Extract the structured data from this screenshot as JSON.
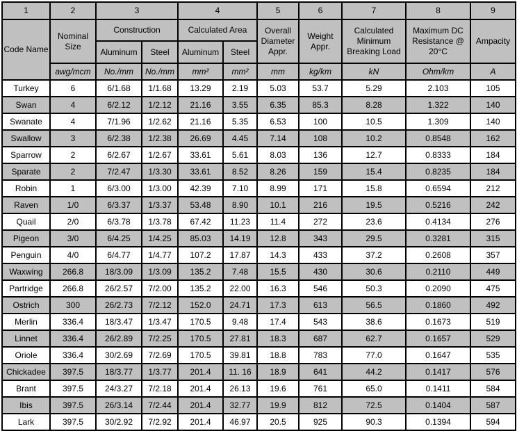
{
  "column_numbers": [
    "1",
    "2",
    "3",
    "4",
    "5",
    "6",
    "7",
    "8",
    "9"
  ],
  "headers": {
    "code_name": "Code Name",
    "nominal_size": "Nominal Size",
    "construction": "Construction",
    "construction_aluminum": "Aluminum",
    "construction_steel": "Steel",
    "calculated_area": "Calculated Area",
    "area_aluminum": "Aluminum",
    "area_steel": "Steel",
    "overall_diameter": "Overall Diameter Appr.",
    "weight": "Weight Appr.",
    "breaking_load": "Calculated Minimum Breaking Load",
    "dc_resistance": "Maximum DC Resistance @ 20°C",
    "ampacity": "Ampacity"
  },
  "units": [
    "awg/mcm",
    "No./mm",
    "No./mm",
    "mm²",
    "mm²",
    "mm",
    "kg/km",
    "kN",
    "Ohm/km",
    "A"
  ],
  "rows": [
    [
      "Turkey",
      "6",
      "6/1.68",
      "1/1.68",
      "13.29",
      "2.19",
      "5.03",
      "53.7",
      "5.29",
      "2.103",
      "105"
    ],
    [
      "Swan",
      "4",
      "6/2.12",
      "1/2.12",
      "21.16",
      "3.55",
      "6.35",
      "85.3",
      "8.28",
      "1.322",
      "140"
    ],
    [
      "Swanate",
      "4",
      "7/1.96",
      "1/2.62",
      "21.16",
      "5.35",
      "6.53",
      "100",
      "10.5",
      "1.309",
      "140"
    ],
    [
      "Swallow",
      "3",
      "6/2.38",
      "1/2.38",
      "26.69",
      "4.45",
      "7.14",
      "108",
      "10.2",
      "0.8548",
      "162"
    ],
    [
      "Sparrow",
      "2",
      "6/2.67",
      "1/2.67",
      "33.61",
      "5.61",
      "8.03",
      "136",
      "12.7",
      "0.8333",
      "184"
    ],
    [
      "Sparate",
      "2",
      "7/2.47",
      "1/3.30",
      "33.61",
      "8.52",
      "8.26",
      "159",
      "15.4",
      "0.8235",
      "184"
    ],
    [
      "Robin",
      "1",
      "6/3.00",
      "1/3.00",
      "42.39",
      "7.10",
      "8.99",
      "171",
      "15.8",
      "0.6594",
      "212"
    ],
    [
      "Raven",
      "1/0",
      "6/3.37",
      "1/3.37",
      "53.48",
      "8.90",
      "10.1",
      "216",
      "19.5",
      "0.5216",
      "242"
    ],
    [
      "Quail",
      "2/0",
      "6/3.78",
      "1/3.78",
      "67.42",
      "11.23",
      "11.4",
      "272",
      "23.6",
      "0.4134",
      "276"
    ],
    [
      "Pigeon",
      "3/0",
      "6/4.25",
      "1/4.25",
      "85.03",
      "14.19",
      "12.8",
      "343",
      "29.5",
      "0.3281",
      "315"
    ],
    [
      "Penguin",
      "4/0",
      "6/4.77",
      "1/4.77",
      "107.2",
      "17.87",
      "14.3",
      "433",
      "37.2",
      "0.2608",
      "357"
    ],
    [
      "Waxwing",
      "266.8",
      "18/3.09",
      "1/3.09",
      "135.2",
      "7.48",
      "15.5",
      "430",
      "30.6",
      "0.2110",
      "449"
    ],
    [
      "Partridge",
      "266.8",
      "26/2.57",
      "7/2.00",
      "135.2",
      "22.00",
      "16.3",
      "546",
      "50.3",
      "0.2090",
      "475"
    ],
    [
      "Ostrich",
      "300",
      "26/2.73",
      "7/2.12",
      "152.0",
      "24.71",
      "17.3",
      "613",
      "56.5",
      "0.1860",
      "492"
    ],
    [
      "Merlin",
      "336.4",
      "18/3.47",
      "1/3.47",
      "170.5",
      "9.48",
      "17.4",
      "543",
      "38.6",
      "0.1673",
      "519"
    ],
    [
      "Linnet",
      "336.4",
      "26/2.89",
      "7/2.25",
      "170.5",
      "27.81",
      "18.3",
      "687",
      "62.7",
      "0.1657",
      "529"
    ],
    [
      "Oriole",
      "336.4",
      "30/2.69",
      "7/2.69",
      "170.5",
      "39.81",
      "18.8",
      "783",
      "77.0",
      "0.1647",
      "535"
    ],
    [
      "Chickadee",
      "397.5",
      "18/3.77",
      "1/3.77",
      "201.4",
      "11. 16",
      "18.9",
      "641",
      "44.2",
      "0.1417",
      "576"
    ],
    [
      "Brant",
      "397.5",
      "24/3.27",
      "7/2.18",
      "201.4",
      "26.13",
      "19.6",
      "761",
      "65.0",
      "0.1411",
      "584"
    ],
    [
      "Ibis",
      "397.5",
      "26/3.14",
      "7/2.44",
      "201.4",
      "32.77",
      "19.9",
      "812",
      "72.5",
      "0.1404",
      "587"
    ],
    [
      "Lark",
      "397.5",
      "30/2.92",
      "7/2.92",
      "201.4",
      "46.97",
      "20.5",
      "925",
      "90.3",
      "0.1394",
      "594"
    ]
  ],
  "colors": {
    "header_bg": "#c0c0c0",
    "stripe_bg": "#c0c0c0",
    "row_bg": "#ffffff",
    "border": "#000000"
  }
}
